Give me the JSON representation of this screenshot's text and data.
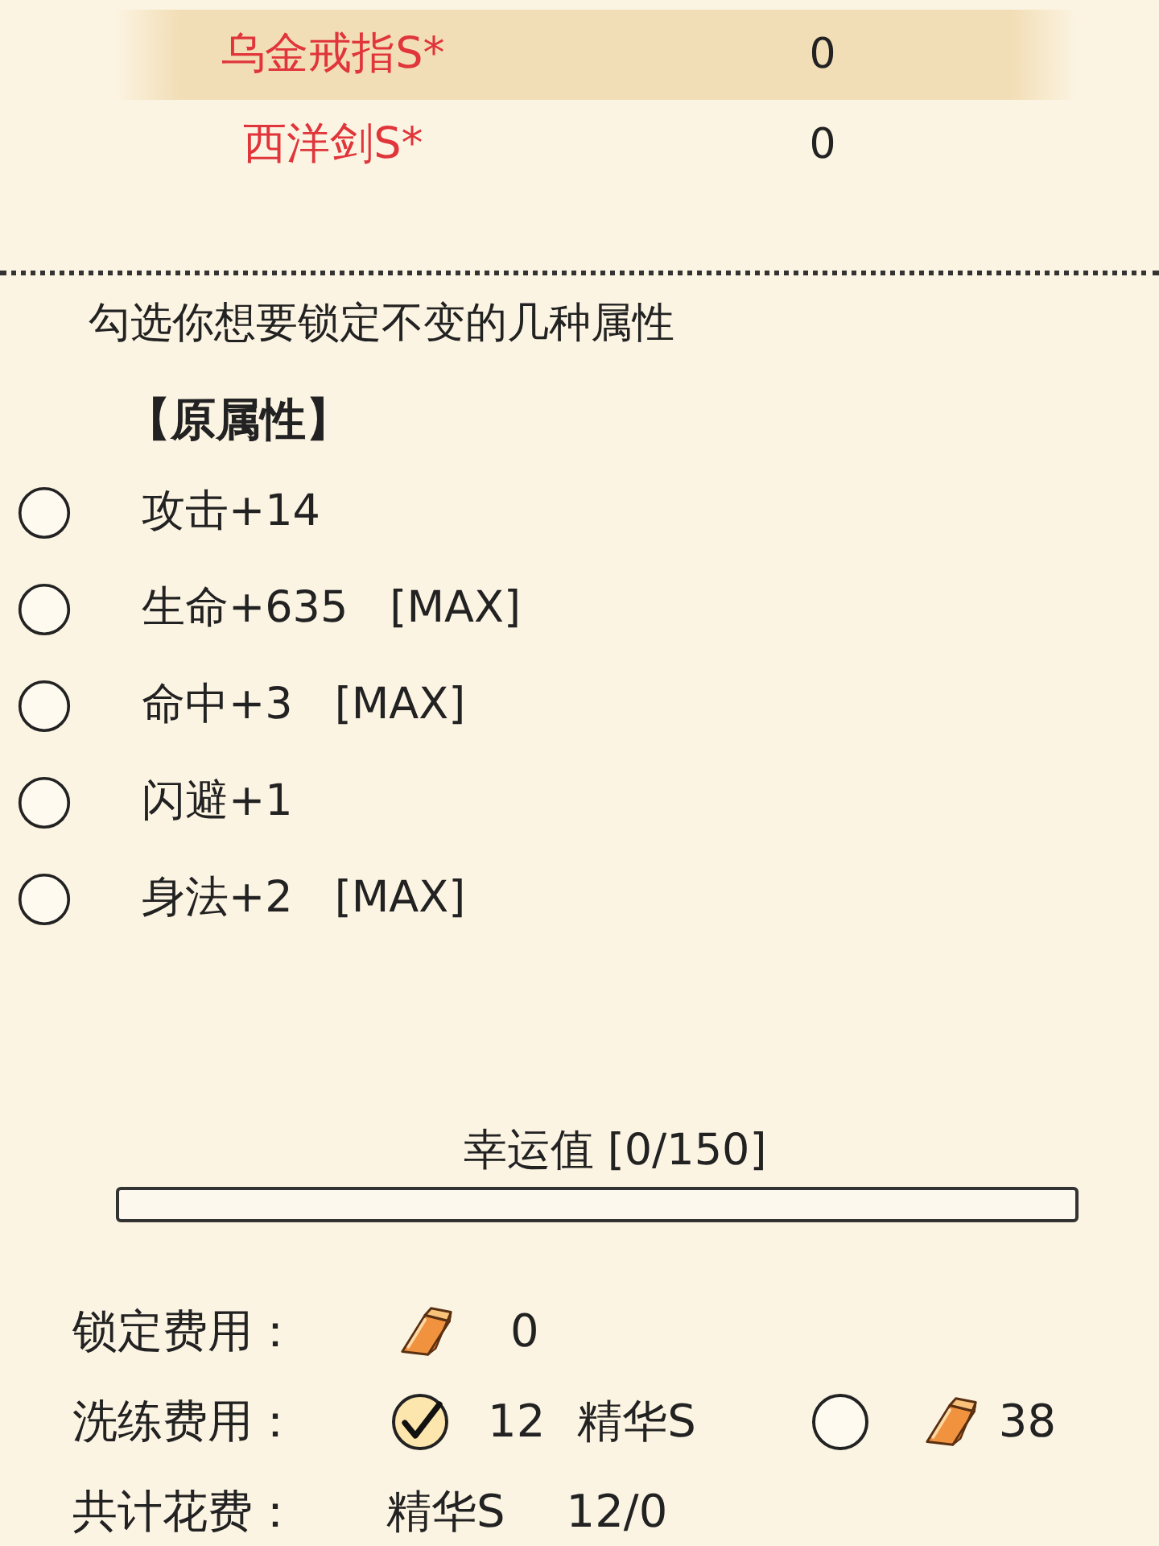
{
  "item_list": [
    {
      "name": "乌金戒指S*",
      "value": "0",
      "selected": true,
      "color": "#e0353a"
    },
    {
      "name": "西洋剑S*",
      "value": "0",
      "selected": false,
      "color": "#e0353a"
    }
  ],
  "instruction": "勾选你想要锁定不变的几种属性",
  "attributes": {
    "heading": "【原属性】",
    "items": [
      {
        "stat": "攻击+14",
        "checked": false
      },
      {
        "stat": "生命+635",
        "max_tag": "[MAX]",
        "checked": false
      },
      {
        "stat": "命中+3",
        "max_tag": "[MAX]",
        "checked": false
      },
      {
        "stat": "闪避+1",
        "checked": false
      },
      {
        "stat": "身法+2",
        "max_tag": "[MAX]",
        "checked": false
      }
    ]
  },
  "luck": {
    "label": "幸运值 [0/150]",
    "level": 0
  },
  "lock_cost": {
    "label": "锁定费用：",
    "amount": "0"
  },
  "refine_cost": {
    "label": "洗练费用：",
    "options": [
      {
        "kind": "essence",
        "selected": true,
        "amount": "12",
        "currency": "精华S"
      },
      {
        "kind": "gold",
        "selected": false,
        "amount": "38"
      }
    ]
  },
  "total_cost": {
    "label": "共计花费：",
    "currency": "精华S",
    "amount": "12/0"
  }
}
